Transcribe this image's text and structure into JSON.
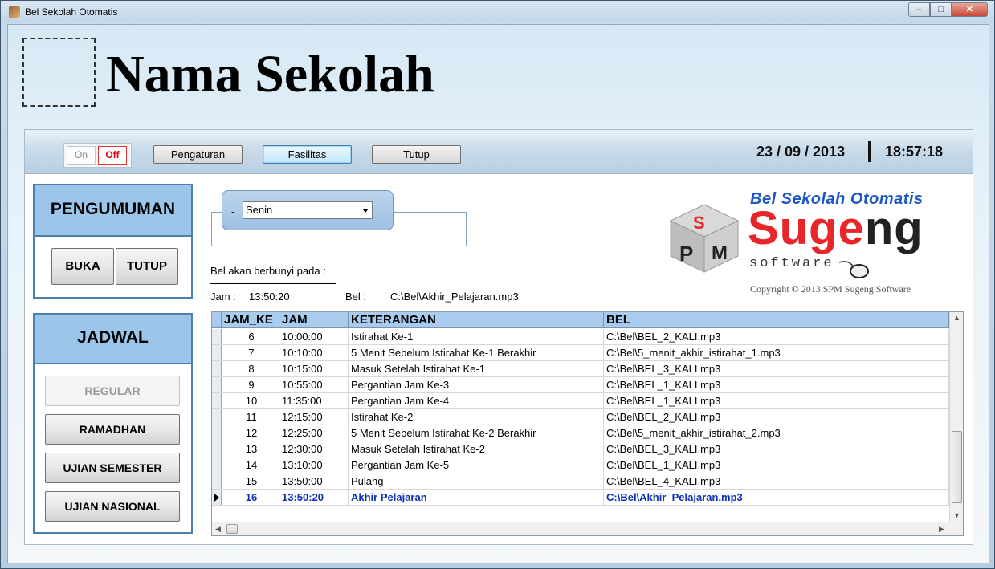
{
  "window": {
    "title": "Bel Sekolah Otomatis"
  },
  "header": {
    "school_name": "Nama Sekolah"
  },
  "toolbar": {
    "on_label": "On",
    "off_label": "Off",
    "pengaturan_label": "Pengaturan",
    "fasilitas_label": "Fasilitas",
    "tutup_label": "Tutup",
    "date": "23 / 09 / 2013",
    "time": "18:57:18"
  },
  "pengumuman": {
    "title": "PENGUMUMAN",
    "buka_label": "BUKA",
    "tutup_label": "TUTUP"
  },
  "jadwal": {
    "title": "JADWAL",
    "regular_label": "REGULAR",
    "ramadhan_label": "RAMADHAN",
    "ujian_semester_label": "UJIAN SEMESTER",
    "ujian_nasional_label": "UJIAN NASIONAL"
  },
  "day_selector": {
    "dash": "-",
    "selected": "Senin"
  },
  "info": {
    "ring_label": "Bel akan berbunyi pada :",
    "jam_label": "Jam :",
    "jam_value": "13:50:20",
    "bel_label": "Bel :",
    "bel_value": "C:\\Bel\\Akhir_Pelajaran.mp3"
  },
  "brand": {
    "title": "Bel Sekolah Otomatis",
    "cube_letters": "SPM",
    "name_red": "Suge",
    "name_dark": "ng",
    "software": "software",
    "copyright": "Copyright © 2013 SPM Sugeng Software",
    "colors": {
      "red": "#e8262a",
      "blue": "#1c57c4"
    }
  },
  "grid": {
    "headers": [
      "JAM_KE",
      "JAM",
      "KETERANGAN",
      "BEL"
    ],
    "rows": [
      [
        "6",
        "10:00:00",
        "Istirahat Ke-1",
        "C:\\Bel\\BEL_2_KALI.mp3"
      ],
      [
        "7",
        "10:10:00",
        "5 Menit Sebelum Istirahat Ke-1 Berakhir",
        "C:\\Bel\\5_menit_akhir_istirahat_1.mp3"
      ],
      [
        "8",
        "10:15:00",
        "Masuk Setelah Istirahat Ke-1",
        "C:\\Bel\\BEL_3_KALI.mp3"
      ],
      [
        "9",
        "10:55:00",
        "Pergantian Jam Ke-3",
        "C:\\Bel\\BEL_1_KALI.mp3"
      ],
      [
        "10",
        "11:35:00",
        "Pergantian Jam Ke-4",
        "C:\\Bel\\BEL_1_KALI.mp3"
      ],
      [
        "11",
        "12:15:00",
        "Istirahat Ke-2",
        "C:\\Bel\\BEL_2_KALI.mp3"
      ],
      [
        "12",
        "12:25:00",
        "5 Menit Sebelum Istirahat Ke-2 Berakhir",
        "C:\\Bel\\5_menit_akhir_istirahat_2.mp3"
      ],
      [
        "13",
        "12:30:00",
        "Masuk Setelah Istirahat Ke-2",
        "C:\\Bel\\BEL_3_KALI.mp3"
      ],
      [
        "14",
        "13:10:00",
        "Pergantian Jam Ke-5",
        "C:\\Bel\\BEL_1_KALI.mp3"
      ],
      [
        "15",
        "13:50:00",
        "Pulang",
        "C:\\Bel\\BEL_4_KALI.mp3"
      ],
      [
        "16",
        "13:50:20",
        "Akhir Pelajaran",
        "C:\\Bel\\Akhir_Pelajaran.mp3"
      ]
    ],
    "selected_row": 10
  }
}
